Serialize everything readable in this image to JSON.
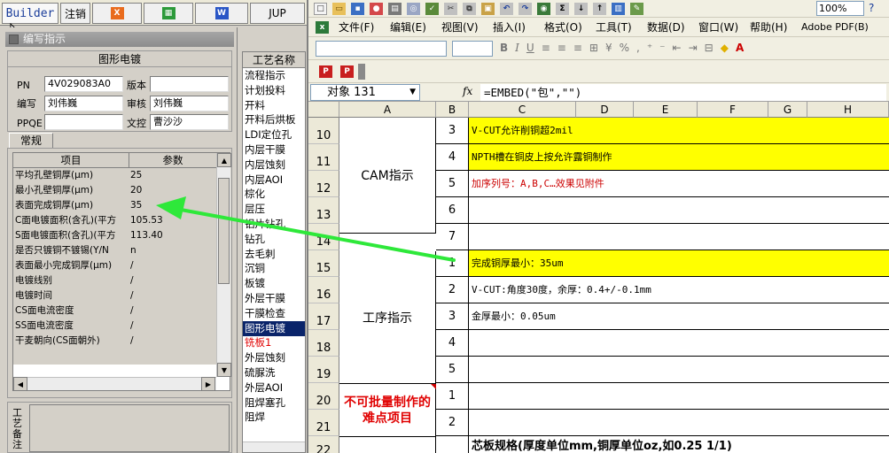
{
  "app": {
    "builder_label": "Builder",
    "logout_label": "注销",
    "excel_icon": "excel-icon",
    "word_icon": "word-icon",
    "jump_label": "JUP"
  },
  "window": {
    "title": "编写指示"
  },
  "header_group": {
    "title": "图形电镀",
    "pn_label": "PN",
    "pn_value": "4V029083A0",
    "version_label": "版本",
    "version_value": "",
    "writer_label": "编写",
    "writer_value": "刘伟巍",
    "reviewer_label": "审核",
    "reviewer_value": "刘伟巍",
    "ppqe_label": "PPQE",
    "ppqe_value": "",
    "controller_label": "文控",
    "controller_value": "曹沙沙"
  },
  "tab": {
    "label": "常规"
  },
  "param_grid": {
    "col_item": "项目",
    "col_param": "参数",
    "rows": [
      {
        "item": "平均孔壁铜厚(μm)",
        "value": "25"
      },
      {
        "item": "最小孔壁铜厚(μm)",
        "value": "20"
      },
      {
        "item": "表面完成铜厚(μm)",
        "value": "35"
      },
      {
        "item": "C面电镀面积(含孔)(平方",
        "value": "105.53"
      },
      {
        "item": "S面电镀面积(含孔)(平方",
        "value": "113.40"
      },
      {
        "item": "是否只镀铜不镀锡(Y/N",
        "value": "n"
      },
      {
        "item": "表面最小完成铜厚(μm)",
        "value": "/"
      },
      {
        "item": "电镀线别",
        "value": "/"
      },
      {
        "item": "电镀时间",
        "value": "/"
      },
      {
        "item": "CS面电流密度",
        "value": "/"
      },
      {
        "item": "SS面电流密度",
        "value": "/"
      },
      {
        "item": "干麦朝向(CS面朝外)",
        "value": "/"
      }
    ]
  },
  "notes": {
    "label": "工艺备注"
  },
  "process_list": {
    "header": "工艺名称",
    "items": [
      {
        "label": "流程指示",
        "state": "normal"
      },
      {
        "label": "计划投料",
        "state": "normal"
      },
      {
        "label": "开料",
        "state": "normal"
      },
      {
        "label": "开料后烘板",
        "state": "normal"
      },
      {
        "label": "LDI定位孔",
        "state": "normal"
      },
      {
        "label": "内层干膜",
        "state": "normal"
      },
      {
        "label": "内层蚀刻",
        "state": "normal"
      },
      {
        "label": "内层AOI",
        "state": "normal"
      },
      {
        "label": "棕化",
        "state": "normal"
      },
      {
        "label": "层压",
        "state": "normal"
      },
      {
        "label": "铝片钻孔",
        "state": "normal"
      },
      {
        "label": "钻孔",
        "state": "normal"
      },
      {
        "label": "去毛刺",
        "state": "normal"
      },
      {
        "label": "沉铜",
        "state": "normal"
      },
      {
        "label": "板镀",
        "state": "normal"
      },
      {
        "label": "外层干膜",
        "state": "normal"
      },
      {
        "label": "干膜检查",
        "state": "normal"
      },
      {
        "label": "图形电镀",
        "state": "selected"
      },
      {
        "label": "铣板1",
        "state": "red"
      },
      {
        "label": "外层蚀刻",
        "state": "normal"
      },
      {
        "label": "硫脲洗",
        "state": "normal"
      },
      {
        "label": "外层AOI",
        "state": "normal"
      },
      {
        "label": "阻焊塞孔",
        "state": "normal"
      },
      {
        "label": "阻焊",
        "state": "normal"
      }
    ]
  },
  "excel": {
    "zoom": "100%",
    "menu": [
      "文件(F)",
      "编辑(E)",
      "视图(V)",
      "插入(I)",
      "格式(O)",
      "工具(T)",
      "数据(D)",
      "窗口(W)",
      "帮助(H)",
      "Adobe PDF(B)"
    ],
    "name_box": "对象 131",
    "fx_symbol": "fx",
    "formula": "=EMBED(\"包\",\"\")",
    "columns": [
      "A",
      "B",
      "C",
      "D",
      "E",
      "F",
      "G",
      "H"
    ],
    "rows": [
      {
        "row": "10",
        "b": "3",
        "c": "V-CUT允许削铜超2mil",
        "fill": "#ffff00",
        "color": "#000000"
      },
      {
        "row": "11",
        "b": "4",
        "c": "NPTH槽在铜皮上按允许露铜制作",
        "fill": "#ffff00",
        "color": "#000000"
      },
      {
        "row": "12",
        "b": "5",
        "c": "加序列号：A,B,C…效果见附件",
        "fill": "#ffffff",
        "color": "#cc0000"
      },
      {
        "row": "13",
        "b": "6",
        "c": "",
        "fill": "#ffffff",
        "color": "#000000"
      },
      {
        "row": "14",
        "b": "7",
        "c": "",
        "fill": "#ffffff",
        "color": "#000000"
      },
      {
        "row": "15",
        "b": "1",
        "c": "完成铜厚最小：35um",
        "fill": "#ffff00",
        "color": "#000000"
      },
      {
        "row": "16",
        "b": "2",
        "c": "V-CUT:角度30度，余厚：0.4+/-0.1mm",
        "fill": "#ffffff",
        "color": "#000000"
      },
      {
        "row": "17",
        "b": "3",
        "c": "金厚最小：0.05um",
        "fill": "#ffffff",
        "color": "#000000"
      },
      {
        "row": "18",
        "b": "4",
        "c": "",
        "fill": "#ffffff",
        "color": "#000000"
      },
      {
        "row": "19",
        "b": "5",
        "c": "",
        "fill": "#ffffff",
        "color": "#000000"
      },
      {
        "row": "20",
        "b": "1",
        "c": "",
        "fill": "#ffffff",
        "color": "#000000"
      },
      {
        "row": "21",
        "b": "2",
        "c": "",
        "fill": "#ffffff",
        "color": "#000000"
      },
      {
        "row": "22",
        "b": "",
        "c": "芯板规格(厚度单位mm,铜厚单位oz,如0.25 1/1)",
        "fill": "#ffffff",
        "color": "#000000"
      }
    ],
    "merged_cam": "CAM指示",
    "merged_process": "工序指示",
    "merged_difficult": "不可批量制作的难点项目"
  },
  "colors": {
    "arrow": "#2ee83a",
    "selected_bg": "#0a246a",
    "yellow": "#ffff00"
  }
}
